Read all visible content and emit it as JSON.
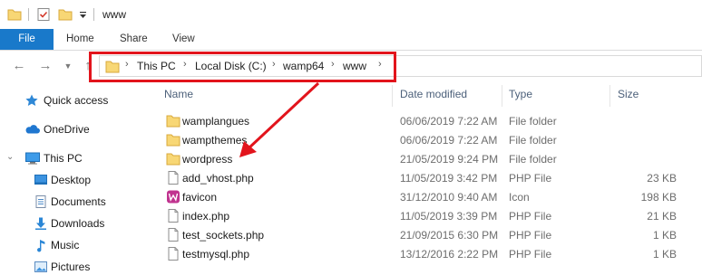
{
  "window": {
    "title": "www"
  },
  "ribbon": {
    "tabs": [
      "File",
      "Home",
      "Share",
      "View"
    ]
  },
  "address": {
    "crumbs": [
      "This PC",
      "Local Disk (C:)",
      "wamp64",
      "www"
    ]
  },
  "nav_pane": {
    "items": [
      {
        "label": "Quick access",
        "icon": "star-icon"
      },
      {
        "label": "OneDrive",
        "icon": "cloud-icon"
      },
      {
        "label": "This PC",
        "icon": "computer-icon"
      },
      {
        "label": "Desktop",
        "icon": "desktop-icon"
      },
      {
        "label": "Documents",
        "icon": "documents-icon"
      },
      {
        "label": "Downloads",
        "icon": "download-icon"
      },
      {
        "label": "Music",
        "icon": "music-icon"
      },
      {
        "label": "Pictures",
        "icon": "pictures-icon"
      }
    ]
  },
  "columns": {
    "name": "Name",
    "date": "Date modified",
    "type": "Type",
    "size": "Size"
  },
  "files": [
    {
      "name": "wamplangues",
      "date": "06/06/2019 7:22 AM",
      "type": "File folder",
      "size": "",
      "icon": "folder-icon"
    },
    {
      "name": "wampthemes",
      "date": "06/06/2019 7:22 AM",
      "type": "File folder",
      "size": "",
      "icon": "folder-icon"
    },
    {
      "name": "wordpress",
      "date": "21/05/2019 9:24 PM",
      "type": "File folder",
      "size": "",
      "icon": "folder-icon"
    },
    {
      "name": "add_vhost.php",
      "date": "11/05/2019 3:42 PM",
      "type": "PHP File",
      "size": "23 KB",
      "icon": "file-icon"
    },
    {
      "name": "favicon",
      "date": "31/12/2010 9:40 AM",
      "type": "Icon",
      "size": "198 KB",
      "icon": "wamp-icon"
    },
    {
      "name": "index.php",
      "date": "11/05/2019 3:39 PM",
      "type": "PHP File",
      "size": "21 KB",
      "icon": "file-icon"
    },
    {
      "name": "test_sockets.php",
      "date": "21/09/2015 6:30 PM",
      "type": "PHP File",
      "size": "1 KB",
      "icon": "file-icon"
    },
    {
      "name": "testmysql.php",
      "date": "13/12/2016 2:22 PM",
      "type": "PHP File",
      "size": "1 KB",
      "icon": "file-icon"
    }
  ],
  "colors": {
    "accent": "#1979ca",
    "annotation": "#e2141c",
    "folder": "#f8d775"
  }
}
